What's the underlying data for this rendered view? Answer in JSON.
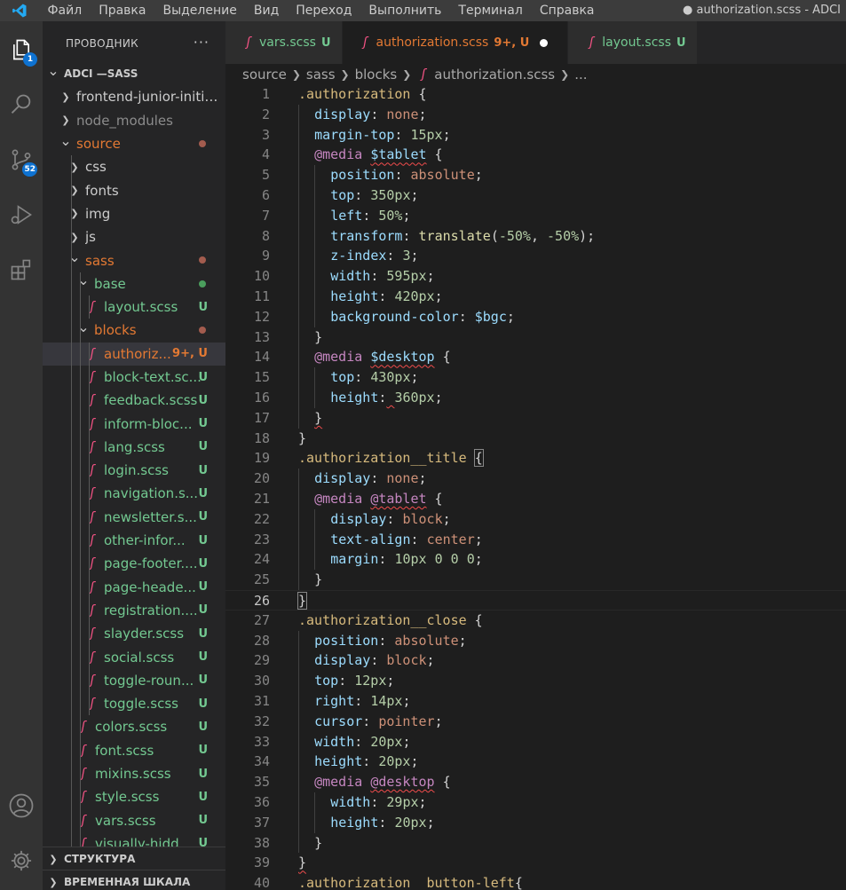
{
  "menu": {
    "items": [
      "Файл",
      "Правка",
      "Выделение",
      "Вид",
      "Переход",
      "Выполнить",
      "Терминал",
      "Справка"
    ],
    "window_title": "● authorization.scss - ADCI"
  },
  "activity_bar": {
    "explorer_badge": "1",
    "scm_badge": "52"
  },
  "sidebar": {
    "title": "ПРОВОДНИК",
    "more": "···",
    "tree": [
      {
        "label": "ADCI —SASS",
        "depth": 0,
        "type": "root",
        "open": true
      },
      {
        "label": "frontend-junior-initial...",
        "depth": 1,
        "type": "folder",
        "open": false
      },
      {
        "label": "node_modules",
        "depth": 1,
        "type": "folder",
        "open": false,
        "dim": true
      },
      {
        "label": "source",
        "depth": 1,
        "type": "folder",
        "open": true,
        "color": "#e37933",
        "dot": "#a35c4e"
      },
      {
        "label": "css",
        "depth": 2,
        "type": "folder",
        "open": false
      },
      {
        "label": "fonts",
        "depth": 2,
        "type": "folder",
        "open": false
      },
      {
        "label": "img",
        "depth": 2,
        "type": "folder",
        "open": false
      },
      {
        "label": "js",
        "depth": 2,
        "type": "folder",
        "open": false
      },
      {
        "label": "sass",
        "depth": 2,
        "type": "folder",
        "open": true,
        "color": "#e37933",
        "dot": "#a35c4e"
      },
      {
        "label": "base",
        "depth": 3,
        "type": "folder",
        "open": true,
        "color": "#73c991",
        "dot": "#4b9f5d"
      },
      {
        "label": "layout.scss",
        "depth": 4,
        "type": "file",
        "status": "U",
        "color": "#73c991"
      },
      {
        "label": "blocks",
        "depth": 3,
        "type": "folder",
        "open": true,
        "color": "#e37933",
        "dot": "#a35c4e"
      },
      {
        "label": "authoriz...",
        "depth": 4,
        "type": "file",
        "status": "9+, U",
        "color": "#e37933",
        "selected": true
      },
      {
        "label": "block-text.sc...",
        "depth": 4,
        "type": "file",
        "status": "U",
        "color": "#73c991"
      },
      {
        "label": "feedback.scss",
        "depth": 4,
        "type": "file",
        "status": "U",
        "color": "#73c991"
      },
      {
        "label": "inform-bloc...",
        "depth": 4,
        "type": "file",
        "status": "U",
        "color": "#73c991"
      },
      {
        "label": "lang.scss",
        "depth": 4,
        "type": "file",
        "status": "U",
        "color": "#73c991"
      },
      {
        "label": "login.scss",
        "depth": 4,
        "type": "file",
        "status": "U",
        "color": "#73c991"
      },
      {
        "label": "navigation.s...",
        "depth": 4,
        "type": "file",
        "status": "U",
        "color": "#73c991"
      },
      {
        "label": "newsletter.s...",
        "depth": 4,
        "type": "file",
        "status": "U",
        "color": "#73c991"
      },
      {
        "label": "other-infor...",
        "depth": 4,
        "type": "file",
        "status": "U",
        "color": "#73c991"
      },
      {
        "label": "page-footer....",
        "depth": 4,
        "type": "file",
        "status": "U",
        "color": "#73c991"
      },
      {
        "label": "page-heade...",
        "depth": 4,
        "type": "file",
        "status": "U",
        "color": "#73c991"
      },
      {
        "label": "registration....",
        "depth": 4,
        "type": "file",
        "status": "U",
        "color": "#73c991"
      },
      {
        "label": "slayder.scss",
        "depth": 4,
        "type": "file",
        "status": "U",
        "color": "#73c991"
      },
      {
        "label": "social.scss",
        "depth": 4,
        "type": "file",
        "status": "U",
        "color": "#73c991"
      },
      {
        "label": "toggle-roun...",
        "depth": 4,
        "type": "file",
        "status": "U",
        "color": "#73c991"
      },
      {
        "label": "toggle.scss",
        "depth": 4,
        "type": "file",
        "status": "U",
        "color": "#73c991"
      },
      {
        "label": "colors.scss",
        "depth": 3,
        "type": "file",
        "status": "U",
        "color": "#73c991"
      },
      {
        "label": "font.scss",
        "depth": 3,
        "type": "file",
        "status": "U",
        "color": "#73c991"
      },
      {
        "label": "mixins.scss",
        "depth": 3,
        "type": "file",
        "status": "U",
        "color": "#73c991"
      },
      {
        "label": "style.scss",
        "depth": 3,
        "type": "file",
        "status": "U",
        "color": "#73c991"
      },
      {
        "label": "vars.scss",
        "depth": 3,
        "type": "file",
        "status": "U",
        "color": "#73c991"
      },
      {
        "label": "visually-hidde...",
        "depth": 3,
        "type": "file",
        "status": "U",
        "color": "#73c991"
      }
    ],
    "outline_label": "СТРУКТУРА",
    "timeline_label": "ВРЕМЕННАЯ ШКАЛА"
  },
  "tabs": [
    {
      "label": "vars.scss",
      "status": "U",
      "label_color": "#73c991",
      "status_color": "#73c991",
      "active": false
    },
    {
      "label": "authorization.scss",
      "status": "9+, U",
      "label_color": "#e37933",
      "status_color": "#e37933",
      "active": true,
      "modified": true
    },
    {
      "label": "layout.scss",
      "status": "U",
      "label_color": "#73c991",
      "status_color": "#73c991",
      "active": false
    }
  ],
  "breadcrumb": {
    "parts": [
      "source",
      "sass",
      "blocks",
      "authorization.scss",
      "..."
    ]
  },
  "editor": {
    "current_line": 26,
    "lines": [
      {
        "n": 1,
        "indent": 0,
        "tokens": [
          [
            "sel",
            ".authorization"
          ],
          [
            "punct",
            " {"
          ]
        ]
      },
      {
        "n": 2,
        "indent": 1,
        "tokens": [
          [
            "prop",
            "display"
          ],
          [
            "punct",
            ": "
          ],
          [
            "val",
            "none"
          ],
          [
            "punct",
            ";"
          ]
        ]
      },
      {
        "n": 3,
        "indent": 1,
        "tokens": [
          [
            "prop",
            "margin-top"
          ],
          [
            "punct",
            ": "
          ],
          [
            "num",
            "15px"
          ],
          [
            "punct",
            ";"
          ]
        ]
      },
      {
        "n": 4,
        "indent": 1,
        "tokens": [
          [
            "at",
            "@media"
          ],
          [
            "punct",
            " "
          ],
          [
            "var-sq",
            "$tablet"
          ],
          [
            "punct",
            " {"
          ]
        ]
      },
      {
        "n": 5,
        "indent": 2,
        "tokens": [
          [
            "prop",
            "position"
          ],
          [
            "punct",
            ": "
          ],
          [
            "val",
            "absolute"
          ],
          [
            "punct",
            ";"
          ]
        ]
      },
      {
        "n": 6,
        "indent": 2,
        "tokens": [
          [
            "prop",
            "top"
          ],
          [
            "punct",
            ": "
          ],
          [
            "num",
            "350px"
          ],
          [
            "punct",
            ";"
          ]
        ]
      },
      {
        "n": 7,
        "indent": 2,
        "tokens": [
          [
            "prop",
            "left"
          ],
          [
            "punct",
            ": "
          ],
          [
            "num",
            "50%"
          ],
          [
            "punct",
            ";"
          ]
        ]
      },
      {
        "n": 8,
        "indent": 2,
        "tokens": [
          [
            "prop",
            "transform"
          ],
          [
            "punct",
            ": "
          ],
          [
            "fn",
            "translate"
          ],
          [
            "punct",
            "("
          ],
          [
            "num",
            "-50%"
          ],
          [
            "punct",
            ", "
          ],
          [
            "num",
            "-50%"
          ],
          [
            "punct",
            ");"
          ]
        ]
      },
      {
        "n": 9,
        "indent": 2,
        "tokens": [
          [
            "prop",
            "z-index"
          ],
          [
            "punct",
            ": "
          ],
          [
            "num",
            "3"
          ],
          [
            "punct",
            ";"
          ]
        ]
      },
      {
        "n": 10,
        "indent": 2,
        "tokens": [
          [
            "prop",
            "width"
          ],
          [
            "punct",
            ": "
          ],
          [
            "num",
            "595px"
          ],
          [
            "punct",
            ";"
          ]
        ]
      },
      {
        "n": 11,
        "indent": 2,
        "tokens": [
          [
            "prop",
            "height"
          ],
          [
            "punct",
            ": "
          ],
          [
            "num",
            "420px"
          ],
          [
            "punct",
            ";"
          ]
        ]
      },
      {
        "n": 12,
        "indent": 2,
        "tokens": [
          [
            "prop",
            "background-color"
          ],
          [
            "punct",
            ": "
          ],
          [
            "var",
            "$bgc"
          ],
          [
            "punct",
            ";"
          ]
        ]
      },
      {
        "n": 13,
        "indent": 1,
        "tokens": [
          [
            "punct",
            "}"
          ]
        ]
      },
      {
        "n": 14,
        "indent": 1,
        "tokens": [
          [
            "at",
            "@media"
          ],
          [
            "punct",
            " "
          ],
          [
            "var-sq",
            "$desktop"
          ],
          [
            "punct",
            " {"
          ]
        ]
      },
      {
        "n": 15,
        "indent": 2,
        "tokens": [
          [
            "prop",
            "top"
          ],
          [
            "punct",
            ": "
          ],
          [
            "num",
            "430px"
          ],
          [
            "punct",
            ";"
          ]
        ]
      },
      {
        "n": 16,
        "indent": 2,
        "tokens": [
          [
            "prop",
            "height"
          ],
          [
            "punct",
            ":"
          ],
          [
            "punct-sq",
            " "
          ],
          [
            "num",
            "360px"
          ],
          [
            "punct",
            ";"
          ]
        ]
      },
      {
        "n": 17,
        "indent": 1,
        "tokens": [
          [
            "punct-sq",
            "}"
          ]
        ]
      },
      {
        "n": 18,
        "indent": 0,
        "tokens": [
          [
            "punct",
            "}"
          ]
        ]
      },
      {
        "n": 19,
        "indent": 0,
        "tokens": [
          [
            "sel",
            ".authorization__title"
          ],
          [
            "punct",
            " "
          ],
          [
            "punct-box",
            "{"
          ]
        ]
      },
      {
        "n": 20,
        "indent": 1,
        "tokens": [
          [
            "prop",
            "display"
          ],
          [
            "punct",
            ": "
          ],
          [
            "val",
            "none"
          ],
          [
            "punct",
            ";"
          ]
        ]
      },
      {
        "n": 21,
        "indent": 1,
        "tokens": [
          [
            "at",
            "@media"
          ],
          [
            "punct",
            " "
          ],
          [
            "at-sq",
            "@tablet"
          ],
          [
            "punct",
            " {"
          ]
        ]
      },
      {
        "n": 22,
        "indent": 2,
        "tokens": [
          [
            "prop",
            "display"
          ],
          [
            "punct",
            ": "
          ],
          [
            "val",
            "block"
          ],
          [
            "punct",
            ";"
          ]
        ]
      },
      {
        "n": 23,
        "indent": 2,
        "tokens": [
          [
            "prop",
            "text-align"
          ],
          [
            "punct",
            ": "
          ],
          [
            "val",
            "center"
          ],
          [
            "punct",
            ";"
          ]
        ]
      },
      {
        "n": 24,
        "indent": 2,
        "tokens": [
          [
            "prop",
            "margin"
          ],
          [
            "punct",
            ": "
          ],
          [
            "num",
            "10px 0 0 0"
          ],
          [
            "punct",
            ";"
          ]
        ]
      },
      {
        "n": 25,
        "indent": 1,
        "tokens": [
          [
            "punct",
            "}"
          ]
        ]
      },
      {
        "n": 26,
        "indent": 0,
        "tokens": [
          [
            "punct-box",
            "}"
          ]
        ]
      },
      {
        "n": 27,
        "indent": 0,
        "tokens": [
          [
            "sel",
            ".authorization__close"
          ],
          [
            "punct",
            " {"
          ]
        ]
      },
      {
        "n": 28,
        "indent": 1,
        "tokens": [
          [
            "prop",
            "position"
          ],
          [
            "punct",
            ": "
          ],
          [
            "val",
            "absolute"
          ],
          [
            "punct",
            ";"
          ]
        ]
      },
      {
        "n": 29,
        "indent": 1,
        "tokens": [
          [
            "prop",
            "display"
          ],
          [
            "punct",
            ": "
          ],
          [
            "val",
            "block"
          ],
          [
            "punct",
            ";"
          ]
        ]
      },
      {
        "n": 30,
        "indent": 1,
        "tokens": [
          [
            "prop",
            "top"
          ],
          [
            "punct",
            ": "
          ],
          [
            "num",
            "12px"
          ],
          [
            "punct",
            ";"
          ]
        ]
      },
      {
        "n": 31,
        "indent": 1,
        "tokens": [
          [
            "prop",
            "right"
          ],
          [
            "punct",
            ": "
          ],
          [
            "num",
            "14px"
          ],
          [
            "punct",
            ";"
          ]
        ]
      },
      {
        "n": 32,
        "indent": 1,
        "tokens": [
          [
            "prop",
            "cursor"
          ],
          [
            "punct",
            ": "
          ],
          [
            "val",
            "pointer"
          ],
          [
            "punct",
            ";"
          ]
        ]
      },
      {
        "n": 33,
        "indent": 1,
        "tokens": [
          [
            "prop",
            "width"
          ],
          [
            "punct",
            ": "
          ],
          [
            "num",
            "20px"
          ],
          [
            "punct",
            ";"
          ]
        ]
      },
      {
        "n": 34,
        "indent": 1,
        "tokens": [
          [
            "prop",
            "height"
          ],
          [
            "punct",
            ": "
          ],
          [
            "num",
            "20px"
          ],
          [
            "punct",
            ";"
          ]
        ]
      },
      {
        "n": 35,
        "indent": 1,
        "tokens": [
          [
            "at",
            "@media"
          ],
          [
            "punct",
            " "
          ],
          [
            "at-sq",
            "@desktop"
          ],
          [
            "punct",
            " {"
          ]
        ]
      },
      {
        "n": 36,
        "indent": 2,
        "tokens": [
          [
            "prop",
            "width"
          ],
          [
            "punct",
            ": "
          ],
          [
            "num",
            "29px"
          ],
          [
            "punct",
            ";"
          ]
        ]
      },
      {
        "n": 37,
        "indent": 2,
        "tokens": [
          [
            "prop",
            "height"
          ],
          [
            "punct",
            ": "
          ],
          [
            "num",
            "20px"
          ],
          [
            "punct",
            ";"
          ]
        ]
      },
      {
        "n": 38,
        "indent": 1,
        "tokens": [
          [
            "punct",
            "}"
          ]
        ]
      },
      {
        "n": 39,
        "indent": 0,
        "tokens": [
          [
            "punct-sq",
            "}"
          ]
        ]
      },
      {
        "n": 40,
        "indent": 0,
        "tokens": [
          [
            "sel",
            ".authorization__button-left"
          ],
          [
            "punct",
            "{"
          ]
        ]
      }
    ]
  },
  "colors": {
    "untracked": "#73c991",
    "modified": "#e37933",
    "sass_icon": "#f55385",
    "badge": "#0e72d1"
  }
}
